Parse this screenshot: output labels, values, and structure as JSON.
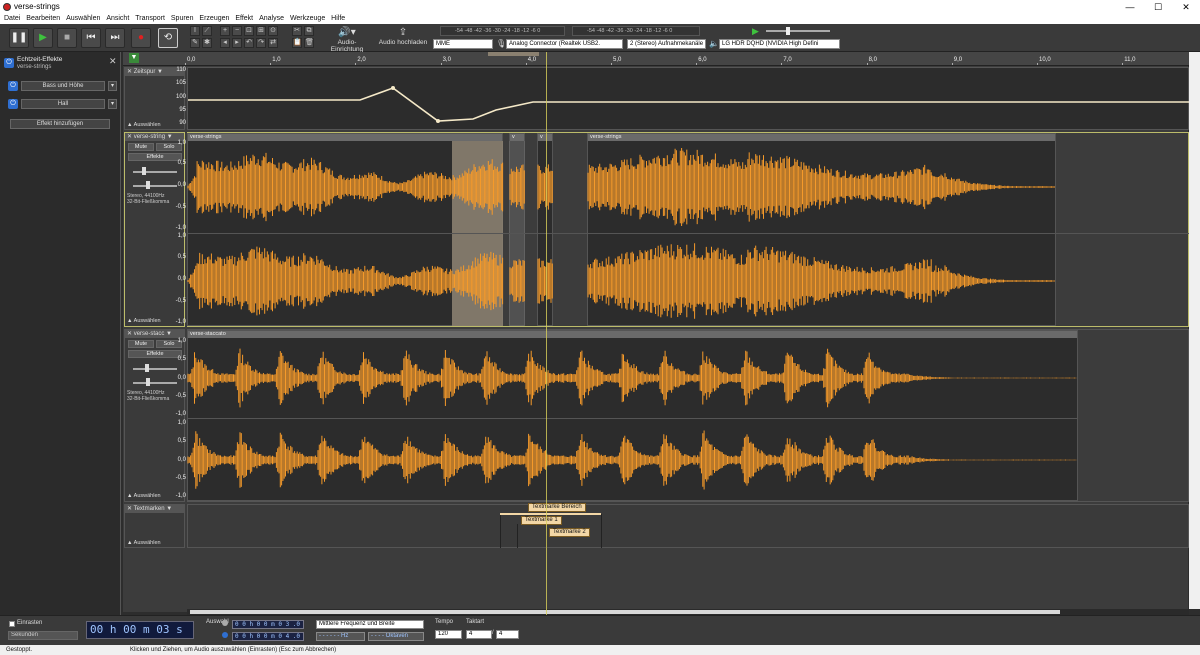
{
  "window": {
    "title": "verse-strings",
    "minimize": "—",
    "maximize": "☐",
    "close": "✕"
  },
  "menu": [
    "Datei",
    "Bearbeiten",
    "Auswählen",
    "Ansicht",
    "Transport",
    "Spuren",
    "Erzeugen",
    "Effekt",
    "Analyse",
    "Werkzeuge",
    "Hilfe"
  ],
  "toolbar": {
    "audio_setup": "Audio-Einrichtung",
    "share_audio": "Audio hochladen",
    "host": "MME",
    "recording_device": "Analog Connector (Realtek USB2.",
    "channels": "2 (Stereo) Aufnahmekanäle",
    "playback_device": "LG HDR DQHD (NVIDIA High Defini",
    "meter_scale": "-54 -48 -42 -36 -30 -24 -18 -12 -6 0"
  },
  "realtime": {
    "title": "Echtzeit-Effekte",
    "track": "verse-strings",
    "effects": [
      "Bass und Höhe",
      "Hall"
    ],
    "add_effect": "Effekt hinzufügen"
  },
  "ruler": {
    "ticks": [
      "0,0",
      "1,0",
      "2,0",
      "3,0",
      "4,0",
      "5,0",
      "6,0",
      "7,0",
      "8,0",
      "9,0",
      "10,0",
      "11,0"
    ]
  },
  "tracks": {
    "time": {
      "name": "Zeitspur",
      "select": "Auswählen",
      "axis": [
        "110",
        "105",
        "100",
        "95",
        "90"
      ]
    },
    "strings": {
      "name": "verse-string",
      "mute": "Mute",
      "solo": "Solo",
      "effects": "Effekte",
      "info": "Stereo, 44100Hz\n32-Bit-Fließkomma",
      "select": "Auswählen",
      "clip_names": [
        "verse-strings",
        "v",
        "v",
        "verse-strings"
      ],
      "axis": [
        "1,0",
        "0,5",
        "0,0",
        "-0,5",
        "-1,0"
      ]
    },
    "staccato": {
      "name": "verse-stacc",
      "mute": "Mute",
      "solo": "Solo",
      "effects": "Effekte",
      "info": "Stereo, 44100Hz\n32-Bit-Fließkomma",
      "select": "Auswählen",
      "clip_name": "verse-staccato",
      "axis": [
        "1,0",
        "0,5",
        "0,0",
        "-0,5",
        "-1,0"
      ]
    },
    "labels": {
      "name": "Textmarken",
      "select": "Auswählen",
      "items": [
        "Textmarke Bereich",
        "Textmarke 1",
        "Textmarke 2"
      ]
    }
  },
  "bottom": {
    "snap": "Einrasten",
    "snap_unit": "Sekunden",
    "time": "00 h 00 m 03 s",
    "selection_label": "Auswahl",
    "sel_start": "0 0 h 0 0 m 0 3 .0 8 0 s",
    "sel_end": "0 0 h 0 0 m 0 4 .0 0 3 s",
    "spectral": "Mittlere Frequenz und Breite",
    "hz": "- - - - - - Hz",
    "octaves": "- - - - Oktaven",
    "tempo_label": "Tempo",
    "tempo": "120",
    "timesig_label": "Taktart",
    "timesig_num": "4",
    "timesig_den": "4"
  },
  "status": {
    "state": "Gestoppt.",
    "hint": "Klicken und Ziehen, um Audio auszuwählen (Einrasten) (Esc zum Abbrechen)"
  },
  "colors": {
    "waveform": "#f59a2a",
    "background": "#2d2d2d",
    "selection": "#8a8070",
    "timeline": "#f5e9c8"
  }
}
